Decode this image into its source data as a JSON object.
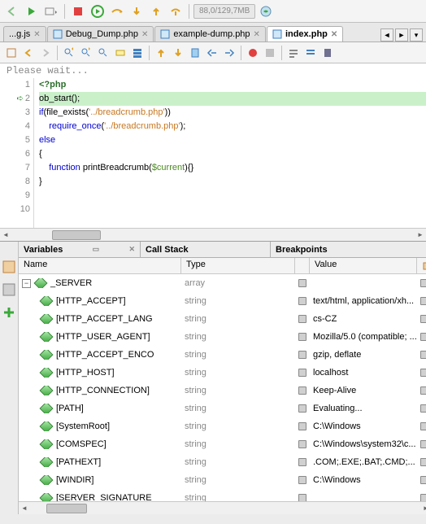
{
  "toolbar": {
    "memory": "88,0/129,7MB"
  },
  "tabs": [
    {
      "label": "...g.js",
      "active": false
    },
    {
      "label": "Debug_Dump.php",
      "active": false
    },
    {
      "label": "example-dump.php",
      "active": false
    },
    {
      "label": "index.php",
      "active": true
    }
  ],
  "editor": {
    "wait": "Please wait...",
    "lines": [
      {
        "n": 1,
        "html": "<span class='kw'>&lt;?php</span>"
      },
      {
        "n": 2,
        "html": "ob_start();",
        "hl": true,
        "cur": true
      },
      {
        "n": 3,
        "html": "<span class='kw2'>if</span>(file_exists(<span class='str'>'../breadcrumb.php'</span>))"
      },
      {
        "n": 4,
        "html": "    <span class='kw2'>require_once</span>(<span class='str'>'../breadcrumb.php'</span>);"
      },
      {
        "n": 5,
        "html": "<span class='kw2'>else</span>"
      },
      {
        "n": 6,
        "html": "{"
      },
      {
        "n": 7,
        "html": "    <span class='kw2'>function</span> printBreadcrumb(<span class='var'>$current</span>){}"
      },
      {
        "n": 8,
        "html": "}"
      },
      {
        "n": 9,
        "html": ""
      },
      {
        "n": 10,
        "html": ""
      }
    ]
  },
  "panels": {
    "variables": "Variables",
    "callstack": "Call Stack",
    "breakpoints": "Breakpoints"
  },
  "cols": {
    "name": "Name",
    "type": "Type",
    "value": "Value"
  },
  "vars": [
    {
      "name": "_SERVER",
      "type": "array",
      "value": "",
      "root": true
    },
    {
      "name": "[HTTP_ACCEPT]",
      "type": "string",
      "value": "text/html, application/xh..."
    },
    {
      "name": "[HTTP_ACCEPT_LANG",
      "type": "string",
      "value": "cs-CZ"
    },
    {
      "name": "[HTTP_USER_AGENT]",
      "type": "string",
      "value": "Mozilla/5.0 (compatible; ..."
    },
    {
      "name": "[HTTP_ACCEPT_ENCO",
      "type": "string",
      "value": "gzip, deflate"
    },
    {
      "name": "[HTTP_HOST]",
      "type": "string",
      "value": "localhost"
    },
    {
      "name": "[HTTP_CONNECTION]",
      "type": "string",
      "value": "Keep-Alive"
    },
    {
      "name": "[PATH]",
      "type": "string",
      "value": "Evaluating..."
    },
    {
      "name": "[SystemRoot]",
      "type": "string",
      "value": "C:\\Windows"
    },
    {
      "name": "[COMSPEC]",
      "type": "string",
      "value": "C:\\Windows\\system32\\c..."
    },
    {
      "name": "[PATHEXT]",
      "type": "string",
      "value": ".COM;.EXE;.BAT;.CMD;..."
    },
    {
      "name": "[WINDIR]",
      "type": "string",
      "value": "C:\\Windows"
    },
    {
      "name": "[SERVER_SIGNATURE",
      "type": "string",
      "value": ""
    }
  ]
}
